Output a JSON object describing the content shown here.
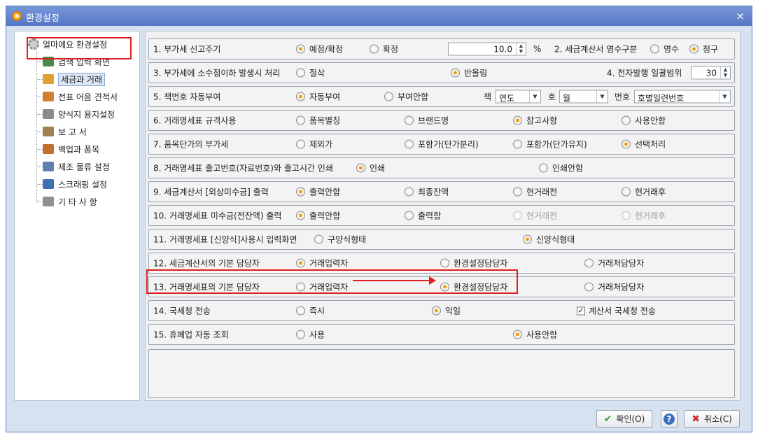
{
  "window": {
    "title": "환경설정",
    "close_glyph": "×"
  },
  "tree": {
    "root": "얼마에요 환경설정",
    "items": [
      {
        "label": "검색 입력 화면",
        "icon": "search-window-icon",
        "color": "#4a8a4a"
      },
      {
        "label": "세금과 거래",
        "icon": "handshake-icon",
        "color": "#e0a030",
        "selected": true
      },
      {
        "label": "전표 어음 견적서",
        "icon": "documents-icon",
        "color": "#d08030"
      },
      {
        "label": "양식지 용지설정",
        "icon": "document-gear-icon",
        "color": "#8a8a8a"
      },
      {
        "label": "보  고  서",
        "icon": "report-icon",
        "color": "#a08050"
      },
      {
        "label": "백업과 폼목",
        "icon": "backup-icon",
        "color": "#c07030"
      },
      {
        "label": "제조 물류 설정",
        "icon": "factory-icon",
        "color": "#6080b0"
      },
      {
        "label": "스크래핑 설정",
        "icon": "scraping-icon",
        "color": "#4070b0"
      },
      {
        "label": "기 타 사 항",
        "icon": "speech-icon",
        "color": "#909090"
      }
    ]
  },
  "settings": {
    "row1": {
      "label": "1. 부가세 신고주기",
      "options": [
        "예정/확정",
        "확정"
      ],
      "selected": 0,
      "rate": "10.0",
      "unit": "%",
      "label2": "2. 세금계산서 영수구분",
      "options2": [
        "영수",
        "청구"
      ],
      "selected2": 1
    },
    "row3": {
      "label": "3. 부가세에 소수점이하 발생시 처리",
      "options": [
        "절삭",
        "반올림"
      ],
      "selected": 1,
      "label2": "4. 전자발행 일괄범위",
      "count": "30"
    },
    "row5": {
      "label": "5. 책번호 자동부여",
      "options": [
        "자동부여",
        "부여안함"
      ],
      "selected": 0,
      "book_label": "책",
      "book_value": "연도",
      "ho_label": "호",
      "ho_value": "월",
      "num_label": "번호",
      "num_value": "호별일련번호"
    },
    "row6": {
      "label": "6. 거래명세표 규격사용",
      "options": [
        "품목별칭",
        "브랜드명",
        "참고사항",
        "사용안함"
      ],
      "selected": 2
    },
    "row7": {
      "label": "7. 품목단가의 부가세",
      "options": [
        "제외가",
        "포함가(단가분리)",
        "포함가(단가유지)",
        "선택처리"
      ],
      "selected": 3
    },
    "row8": {
      "label": "8. 거래명세표 출고번호(자료번호)와 출고시간 인쇄",
      "options": [
        "인쇄",
        "인쇄안함"
      ],
      "selected": 0
    },
    "row9": {
      "label": "9. 세금계산서 [외상미수금] 출력",
      "options": [
        "출력안함",
        "최종잔액",
        "현거래전",
        "현거래후"
      ],
      "selected": 0
    },
    "row10": {
      "label": "10. 거래명세표 미수금(전잔액) 출력",
      "options": [
        "출력안함",
        "출력함",
        "현거래전",
        "현거래후"
      ],
      "selected": 0,
      "disabled": [
        2,
        3
      ]
    },
    "row11": {
      "label": "11. 거래명세표 [신양식]사용시 입력화면",
      "options": [
        "구양식형태",
        "신양식형태"
      ],
      "selected": 1
    },
    "row12": {
      "label": "12. 세금계산서의 기본 담당자",
      "options": [
        "거래입력자",
        "환경설정담당자",
        "거래처담당자"
      ],
      "selected": 0
    },
    "row13": {
      "label": "13. 거래명세표의 기본 담당자",
      "options": [
        "거래입력자",
        "환경설정담당자",
        "거래처담당자"
      ],
      "selected": 1
    },
    "row14": {
      "label": "14. 국세청 전송",
      "options": [
        "즉시",
        "익일"
      ],
      "selected": 1,
      "check_label": "계산서 국세청 전송",
      "checked": true
    },
    "row15": {
      "label": "15. 휴폐업 자동 조회",
      "options": [
        "사용",
        "사용안함"
      ],
      "selected": 1
    }
  },
  "buttons": {
    "ok": "확인(O)",
    "help": "?",
    "cancel": "취소(C)"
  },
  "colors": {
    "accent_radio": "#f0a000",
    "highlight": "#e02020",
    "title_bar": "#5676c6"
  }
}
